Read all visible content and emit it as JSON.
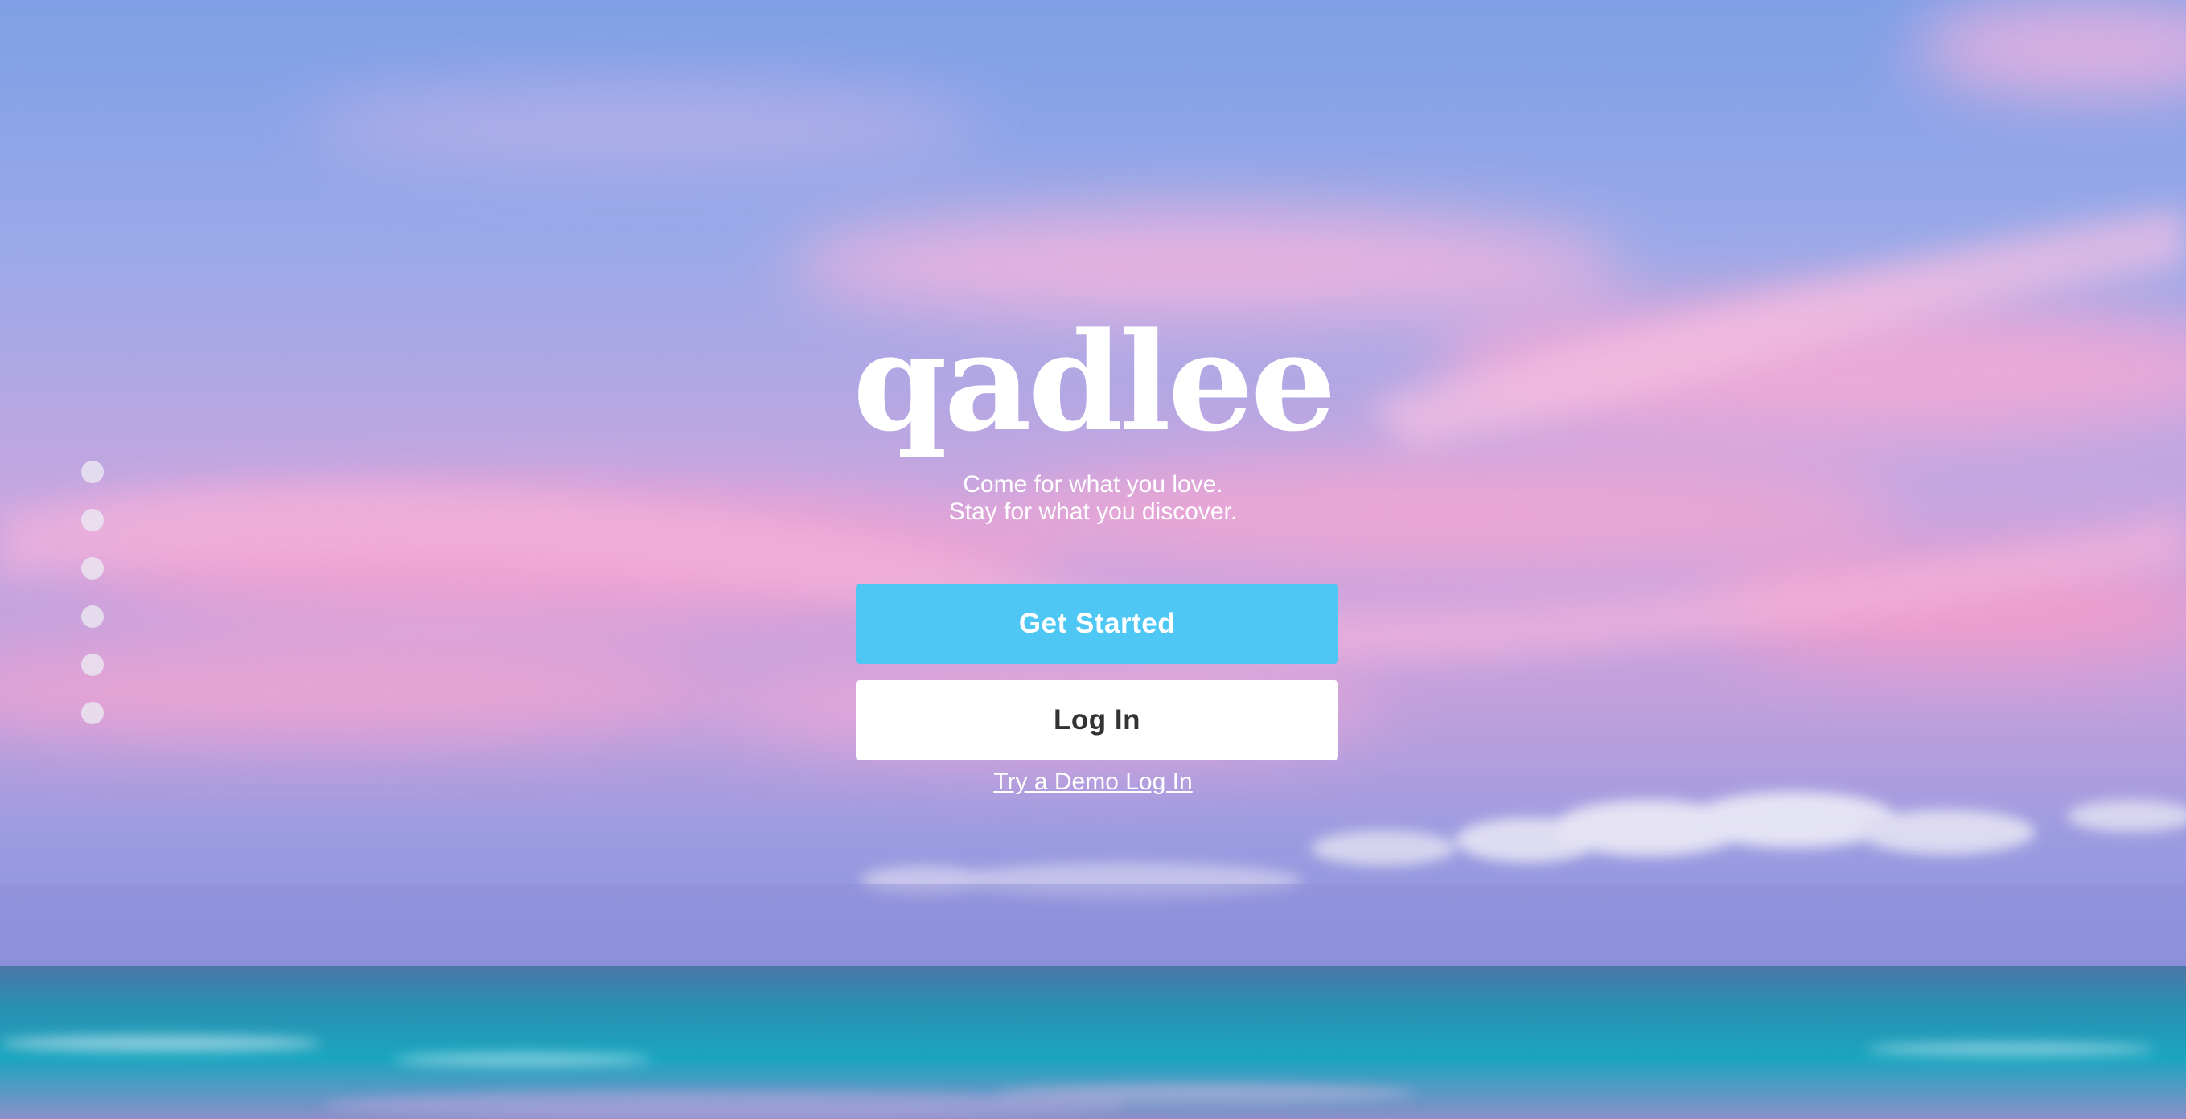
{
  "app": {
    "logo": "qadlee",
    "tagline_line1": "Come for what you love.",
    "tagline_line2": "Stay for what you discover."
  },
  "actions": {
    "get_started_label": "Get Started",
    "login_label": "Log In",
    "demo_label": "Try a Demo Log In"
  },
  "slide_nav": {
    "count": 6,
    "active_index": 0
  },
  "colors": {
    "primary_button": "#4fc7f4",
    "secondary_button": "#ffffff",
    "secondary_button_text": "#333333",
    "text": "#ffffff"
  }
}
